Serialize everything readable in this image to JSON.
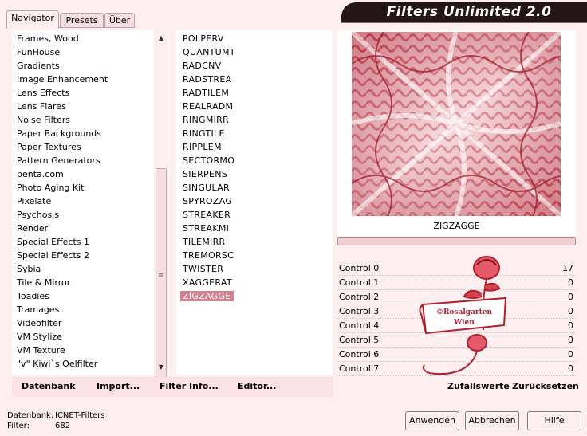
{
  "tabs": [
    {
      "label": "Navigator"
    },
    {
      "label": "Presets"
    },
    {
      "label": "Über"
    }
  ],
  "app_title": "Filters Unlimited 2.0",
  "categories": [
    {
      "label": "Frames, Wood"
    },
    {
      "label": "FunHouse"
    },
    {
      "label": "Gradients"
    },
    {
      "label": "Image Enhancement"
    },
    {
      "label": "Lens Effects"
    },
    {
      "label": "Lens Flares"
    },
    {
      "label": "Noise Filters"
    },
    {
      "label": "Paper Backgrounds"
    },
    {
      "label": "Paper Textures"
    },
    {
      "label": "Pattern Generators"
    },
    {
      "label": "penta.com"
    },
    {
      "label": "Photo Aging Kit"
    },
    {
      "label": "Pixelate"
    },
    {
      "label": "Psychosis"
    },
    {
      "label": "Render"
    },
    {
      "label": "Special Effects 1"
    },
    {
      "label": "Special Effects 2"
    },
    {
      "label": "Sybia"
    },
    {
      "label": "Tile & Mirror"
    },
    {
      "label": "Toadies"
    },
    {
      "label": "Tramages"
    },
    {
      "label": "Videofilter"
    },
    {
      "label": "VM Stylize"
    },
    {
      "label": "VM Texture"
    },
    {
      "label": "\"v\" Kiwi`s Oelfilter"
    }
  ],
  "filters": [
    {
      "label": "POLPERV"
    },
    {
      "label": "QUANTUMT"
    },
    {
      "label": "RADCNV"
    },
    {
      "label": "RADSTREA"
    },
    {
      "label": "RADTILEM"
    },
    {
      "label": "REALRADM"
    },
    {
      "label": "RINGMIRR"
    },
    {
      "label": "RINGTILE"
    },
    {
      "label": "RIPPLEMI"
    },
    {
      "label": "SECTORMO"
    },
    {
      "label": "SIERPENS"
    },
    {
      "label": "SINGULAR"
    },
    {
      "label": "SPYROZAG"
    },
    {
      "label": "STREAKER"
    },
    {
      "label": "STREAKMI"
    },
    {
      "label": "TILEMIRR"
    },
    {
      "label": "TREMORSC"
    },
    {
      "label": "TWISTER"
    },
    {
      "label": "XAGGERAT"
    },
    {
      "label": "ZIGZAGGE"
    }
  ],
  "selected_filter": "ZIGZAGGE",
  "controls": [
    {
      "label": "Control 0",
      "value": "17"
    },
    {
      "label": "Control 1",
      "value": "0"
    },
    {
      "label": "Control 2",
      "value": "0"
    },
    {
      "label": "Control 3",
      "value": "0"
    },
    {
      "label": "Control 4",
      "value": "0"
    },
    {
      "label": "Control 5",
      "value": "0"
    },
    {
      "label": "Control 6",
      "value": "0"
    },
    {
      "label": "Control 7",
      "value": "0"
    }
  ],
  "watermark_text": [
    "©Rosalgarten",
    "Wien"
  ],
  "toolbar": {
    "database": "Datenbank",
    "import": "Import...",
    "filter_info": "Filter Info...",
    "editor": "Editor...",
    "random": "Zufallswerte",
    "reset": "Zurücksetzen"
  },
  "status": {
    "database_label": "Datenbank:",
    "database_value": "ICNET-Filters",
    "filter_label": "Filter:",
    "filter_value": "682"
  },
  "buttons": {
    "apply": "Anwenden",
    "cancel": "Abbrechen",
    "help": "Hilfe"
  },
  "colors": {
    "background": "#fdeef0",
    "accent": "#b0202d",
    "selection": "#d77f8e",
    "banner": "#241516"
  },
  "icons": {
    "scroll_up": "up-arrow-icon",
    "scroll_down": "down-arrow-icon"
  }
}
